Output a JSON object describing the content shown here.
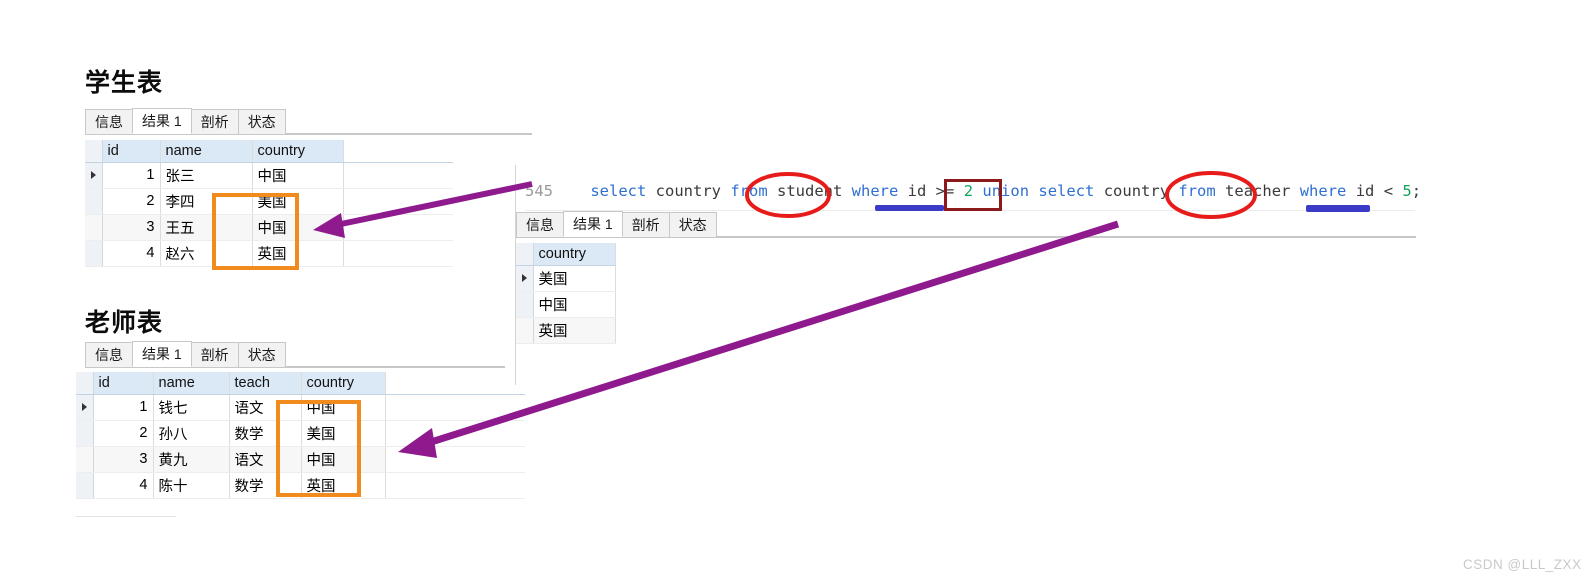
{
  "watermark": "CSDN @LLL_ZXX",
  "student_section": {
    "title": "学生表",
    "tabs": [
      {
        "label": "信息",
        "active": false
      },
      {
        "label": "结果 1",
        "active": true
      },
      {
        "label": "剖析",
        "active": false
      },
      {
        "label": "状态",
        "active": false
      }
    ],
    "columns": [
      "id",
      "name",
      "country"
    ],
    "rows": [
      {
        "id": "1",
        "name": "张三",
        "country": "中国",
        "selected": true
      },
      {
        "id": "2",
        "name": "李四",
        "country": "美国",
        "selected": false
      },
      {
        "id": "3",
        "name": "王五",
        "country": "中国",
        "selected": false
      },
      {
        "id": "4",
        "name": "赵六",
        "country": "英国",
        "selected": false
      }
    ]
  },
  "teacher_section": {
    "title": "老师表",
    "tabs": [
      {
        "label": "信息",
        "active": false
      },
      {
        "label": "结果 1",
        "active": true
      },
      {
        "label": "剖析",
        "active": false
      },
      {
        "label": "状态",
        "active": false
      }
    ],
    "columns": [
      "id",
      "name",
      "teach",
      "country"
    ],
    "rows": [
      {
        "id": "1",
        "name": "钱七",
        "teach": "语文",
        "country": "中国",
        "selected": true
      },
      {
        "id": "2",
        "name": "孙八",
        "teach": "数学",
        "country": "美国",
        "selected": false
      },
      {
        "id": "3",
        "name": "黄九",
        "teach": "语文",
        "country": "中国",
        "selected": false
      },
      {
        "id": "4",
        "name": "陈十",
        "teach": "数学",
        "country": "英国",
        "selected": false
      }
    ]
  },
  "query_panel": {
    "line_number": "545",
    "sql_full": "select country from student where id >= 2 union select country from teacher where id < 5;",
    "tokens": [
      {
        "t": "select",
        "k": "kw"
      },
      {
        "t": " country ",
        "k": "id2"
      },
      {
        "t": "from",
        "k": "kw"
      },
      {
        "t": " student ",
        "k": "id2"
      },
      {
        "t": "where",
        "k": "kw"
      },
      {
        "t": " id ",
        "k": "id2"
      },
      {
        "t": ">=",
        "k": "op"
      },
      {
        "t": " ",
        "k": "id2"
      },
      {
        "t": "2",
        "k": "num2"
      },
      {
        "t": " ",
        "k": "id2"
      },
      {
        "t": "union",
        "k": "kw"
      },
      {
        "t": " ",
        "k": "id2"
      },
      {
        "t": "select",
        "k": "kw"
      },
      {
        "t": " country ",
        "k": "id2"
      },
      {
        "t": "from",
        "k": "kw"
      },
      {
        "t": " teacher ",
        "k": "id2"
      },
      {
        "t": "where",
        "k": "kw"
      },
      {
        "t": " id ",
        "k": "id2"
      },
      {
        "t": "<",
        "k": "op"
      },
      {
        "t": " ",
        "k": "id2"
      },
      {
        "t": "5",
        "k": "num2"
      },
      {
        "t": ";",
        "k": "op"
      }
    ],
    "tabs": [
      {
        "label": "信息",
        "active": false
      },
      {
        "label": "结果 1",
        "active": true
      },
      {
        "label": "剖析",
        "active": false
      },
      {
        "label": "状态",
        "active": false
      }
    ],
    "columns": [
      "country"
    ],
    "rows": [
      {
        "country": "美国",
        "selected": true
      },
      {
        "country": "中国",
        "selected": false
      },
      {
        "country": "英国",
        "selected": false
      }
    ]
  },
  "annotations": {
    "highlight_color": "#f28b1e",
    "union_box_color": "#8d1a1a",
    "ellipse_color": "#e81b1b",
    "arrow_color": "#8e1a8e",
    "underline_color": "#3b3bc8",
    "circled_terms": [
      "student",
      "teacher"
    ],
    "boxed_term": "union",
    "underlined_terms": [
      "id >= 2",
      "id < 5"
    ]
  }
}
